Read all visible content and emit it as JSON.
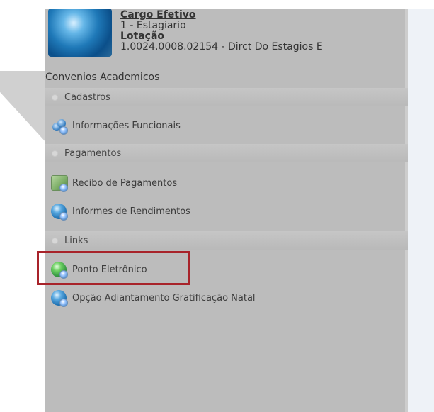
{
  "user": {
    "cargo_label": "Cargo Efetivo",
    "cargo_value": "1 - Estagiario",
    "lotacao_label": "Lotação",
    "lotacao_value": "1.0024.0008.02154 - Dirct Do Estagios E",
    "lotacao_value_cont": "Convenios Academicos"
  },
  "menu": {
    "cadastros": {
      "header": "Cadastros",
      "items": [
        {
          "label": "Informações Funcionais",
          "icon": "people-icon"
        }
      ]
    },
    "pagamentos": {
      "header": "Pagamentos",
      "items": [
        {
          "label": "Recibo de Pagamentos",
          "icon": "money-icon"
        },
        {
          "label": "Informes de Rendimentos",
          "icon": "globe-icon"
        }
      ]
    },
    "links": {
      "header": "Links",
      "items": [
        {
          "label": "Ponto Eletrônico",
          "icon": "green-globe-icon"
        },
        {
          "label": "Opção Adiantamento Gratificação Natal",
          "icon": "globe-icon"
        }
      ]
    }
  },
  "colors": {
    "panel": "#bcbcbc",
    "header": "#c1c1c1",
    "highlight": "#a8232a",
    "right_area": "#eef2f7"
  }
}
